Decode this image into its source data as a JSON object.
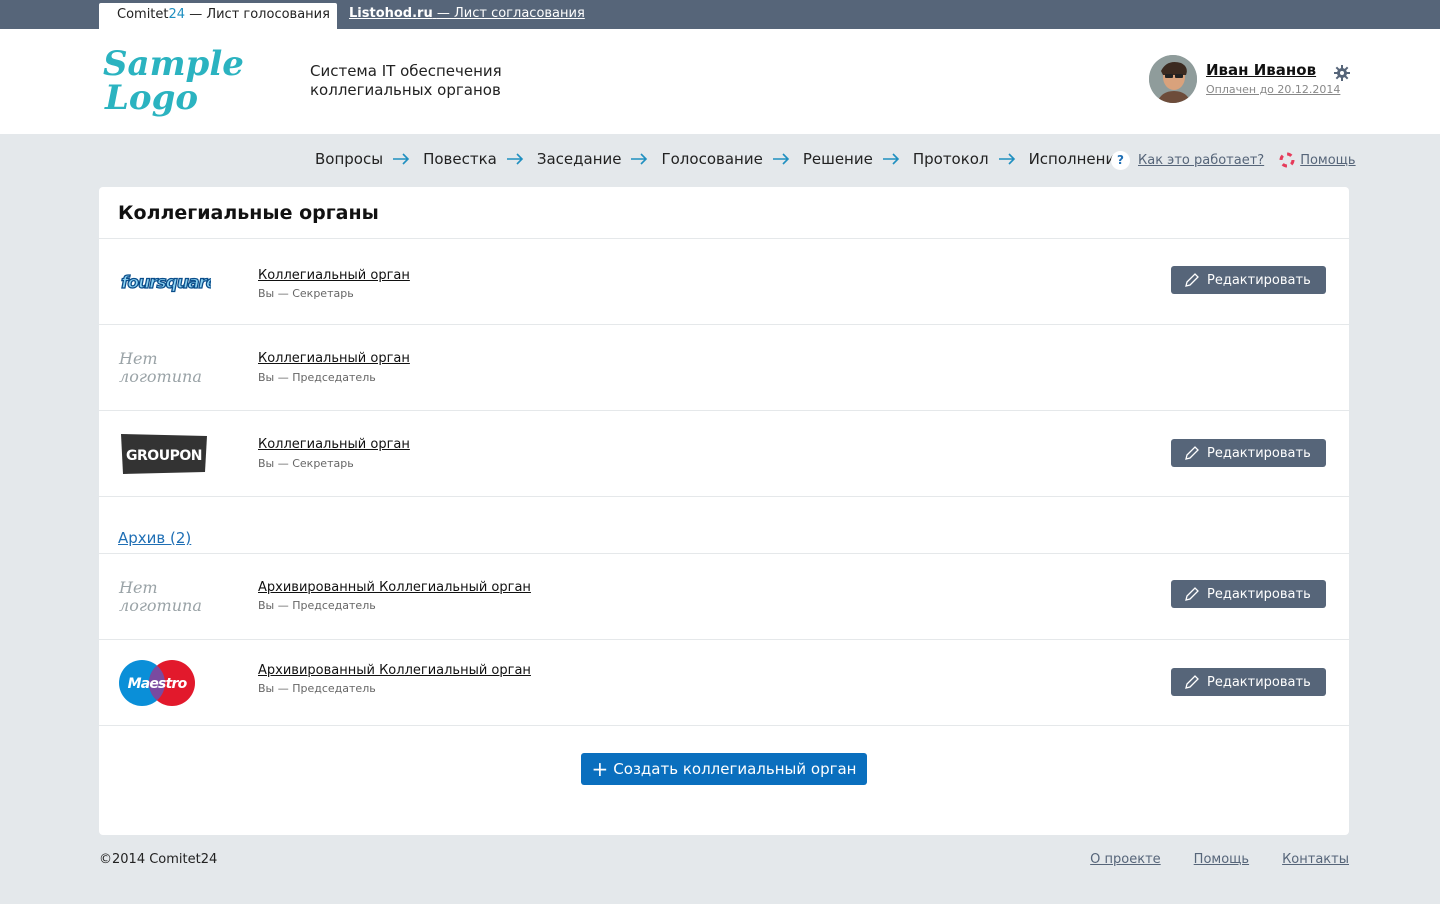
{
  "tabs": {
    "active": {
      "brand": "Comitet",
      "brand_accent": "24",
      "label": "— Лист голосования"
    },
    "other": {
      "brand": "Listohod.ru",
      "label": "— Лист согласования"
    }
  },
  "header": {
    "logo_line1": "Sample",
    "logo_line2": "Logo",
    "tagline_line1": "Система IT обеспечения",
    "tagline_line2": "коллегиальных органов",
    "user_name": "Иван Иванов",
    "paid_until": "Оплачен до 20.12.2014"
  },
  "steps": [
    "Вопросы",
    "Повестка",
    "Заседание",
    "Голосование",
    "Решение",
    "Протокол",
    "Исполнение"
  ],
  "help": {
    "how_it_works": "Как это работает?",
    "help": "Помощь"
  },
  "card": {
    "title": "Коллегиальные органы",
    "edit_label": "Редактировать",
    "no_logo_line1": "Нет",
    "no_logo_line2": "логотипа",
    "items": [
      {
        "name": "Коллегиальный орган",
        "role": "Вы — Секретарь",
        "logo": "foursquare",
        "editable": true
      },
      {
        "name": "Коллегиальный орган",
        "role": "Вы — Председатель",
        "logo": "none",
        "editable": false
      },
      {
        "name": "Коллегиальный орган",
        "role": "Вы — Секретарь",
        "logo": "GROUPON",
        "editable": true
      }
    ],
    "archive_label": "Архив (2)",
    "archive_items": [
      {
        "name": "Архивированный Коллегиальный орган",
        "role": "Вы — Председатель",
        "logo": "none",
        "editable": true
      },
      {
        "name": "Архивированный Коллегиальный орган",
        "role": "Вы — Председатель",
        "logo": "Maestro",
        "editable": true
      }
    ],
    "create_label": "Создать коллегиальный орган"
  },
  "footer": {
    "copyright": "©2014 Comitet24",
    "links": [
      "О проекте",
      "Помощь",
      "Контакты"
    ]
  },
  "colors": {
    "topbar": "#566579",
    "accent": "#1f8fc0",
    "primary_button": "#0a6fbe",
    "secondary_button": "#566579",
    "background": "#e4e8eb"
  }
}
